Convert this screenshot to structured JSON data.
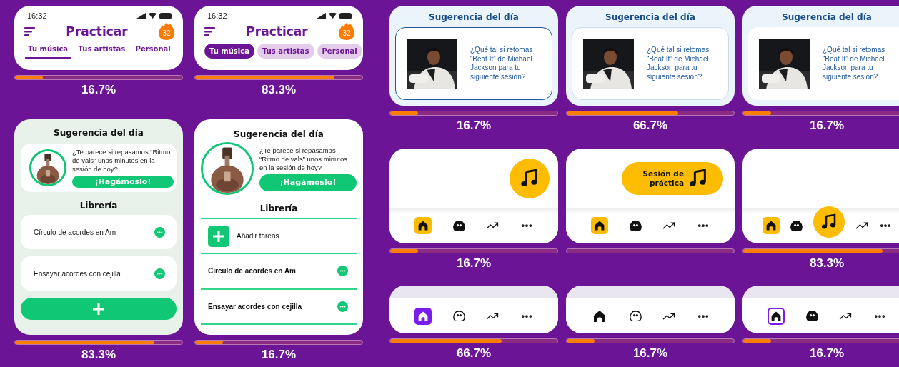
{
  "header_variants": [
    {
      "kind": "underline",
      "time": "16:32",
      "title": "Practicar",
      "streak": "32",
      "tabs": [
        {
          "label": "Tu música",
          "selected": true
        },
        {
          "label": "Tus artistas",
          "selected": false
        },
        {
          "label": "Personal",
          "selected": false
        }
      ],
      "level": 0.167,
      "percent": "16.7%"
    },
    {
      "kind": "pills",
      "time": "16:32",
      "title": "Practicar",
      "streak": "32",
      "tabs": [
        {
          "label": "Tu música",
          "selected": true
        },
        {
          "label": "Tus artistas",
          "selected": false
        },
        {
          "label": "Personal",
          "selected": false
        }
      ],
      "level": 0.833,
      "percent": "83.3%"
    }
  ],
  "library_variants": [
    {
      "kind": "cards",
      "suggestion": {
        "title": "Sugerencia del día",
        "text": "¿Te parece si repasamos “Ritmo de vals” unos minutos en la sesión de hoy?",
        "action": "¡Hagámoslo!"
      },
      "library_title": "Librería",
      "tasks": [
        "Círculo de acordes en Am",
        "Ensayar acordes con cejilla"
      ],
      "level": 0.833,
      "percent": "83.3%"
    },
    {
      "kind": "list",
      "suggestion": {
        "title": "Sugerencia del día",
        "text": "¿Te parece si repasamos “Ritmo de vals” unos minutos en la sesión de hoy?",
        "action": "¡Hagámoslo!"
      },
      "library_title": "Librería",
      "add_label": "Añadir tareas",
      "tasks": [
        "Círculo de acordes en Am",
        "Ensayar acordes con cejilla"
      ],
      "level": 0.167,
      "percent": "16.7%"
    }
  ],
  "suggestion_variants": [
    {
      "kind": "outlined",
      "title": "Sugerencia del día",
      "text": "¿Qué tal si retomas “Beat It” de Michael Jackson para tu siguiente sesión?",
      "level": 0.167,
      "percent": "16.7%"
    },
    {
      "kind": "soft",
      "title": "Sugerencia del día",
      "text": "¿Qué tal si retomas “Beat It” de Michael Jackson para tu siguiente sesión?",
      "level": 0.667,
      "percent": "66.7%"
    },
    {
      "kind": "flat",
      "title": "Sugerencia del día",
      "text": "¿Qué tal si retomas “Beat It” de Michael Jackson para tu siguiente sesión?",
      "level": 0.167,
      "percent": "16.7%"
    }
  ],
  "fab_variants": [
    {
      "kind": "circle",
      "level": 0.167,
      "percent": "16.7%"
    },
    {
      "kind": "extended",
      "label": "Sesión de práctica"
    },
    {
      "kind": "docked",
      "level": 0.833,
      "percent": "83.3%"
    }
  ],
  "nav_variants": [
    {
      "kind": "filled",
      "level": 0.667,
      "percent": "66.7%"
    },
    {
      "kind": "plain",
      "level": 0.167,
      "percent": "16.7%"
    },
    {
      "kind": "outlined",
      "level": 0.167,
      "percent": "16.7%"
    }
  ]
}
